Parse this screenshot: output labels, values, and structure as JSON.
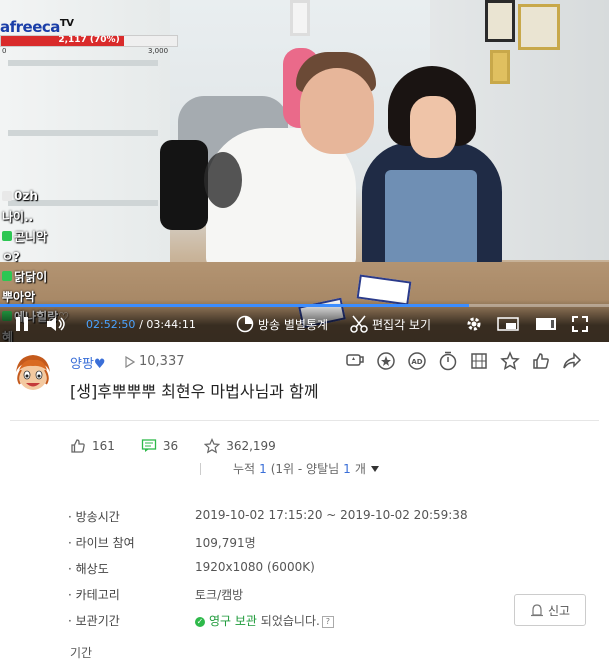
{
  "overlay": {
    "logo": "afreeca",
    "logo_tv": "TV",
    "goal_progress_text": "2,117 (70%)",
    "goal_progress": 0.7,
    "goal_min": "0",
    "goal_max": "3,000"
  },
  "chat": [
    {
      "text": "0zh",
      "color": "#e8e8e8"
    },
    {
      "text": "나이..",
      "color": ""
    },
    {
      "text": "곤니악",
      "color": "#2dc653"
    },
    {
      "text": "ㅇ?",
      "color": ""
    },
    {
      "text": "닭닭이",
      "color": "#2dc653"
    },
    {
      "text": "뿌아악",
      "color": ""
    },
    {
      "text": "에나힐랑♡",
      "color": "#2dc653"
    },
    {
      "text": "혜",
      "color": ""
    }
  ],
  "player": {
    "current_time": "02:52:50",
    "total_time": "/ 03:44:11",
    "played_fraction": 0.77,
    "separate_stats_label": "방송 별별통계",
    "edit_view_label": "편집각 보기"
  },
  "info": {
    "streamer": "양팡",
    "view_count": "10,337",
    "title": "[생]후뿌뿌뿌 최현우 마법사님과 함께",
    "likes": "161",
    "comments": "36",
    "stars": "362,199",
    "cumulative_prefix": "누적",
    "cumulative_count": "1",
    "cumulative_rank_prefix": "(1위 - 양탈님",
    "cumulative_rank_count": "1",
    "cumulative_rank_suffix": "개",
    "accent_color": "#3a6fd8"
  },
  "details": [
    {
      "label": "· 방송시간",
      "value": "2019-10-02 17:15:20 ~ 2019-10-02 20:59:38"
    },
    {
      "label": "· 라이브 참여",
      "value": "109,791명"
    },
    {
      "label": "· 해상도",
      "value": "1920x1080 (6000K)"
    },
    {
      "label": "· 카테고리",
      "value": "토크/캠방"
    }
  ],
  "storage": {
    "label": "· 보관기간",
    "value_green": "영구 보관",
    "value_rest": " 되었습니다.",
    "help": "?"
  },
  "report_label": "신고",
  "next_label": "기간"
}
